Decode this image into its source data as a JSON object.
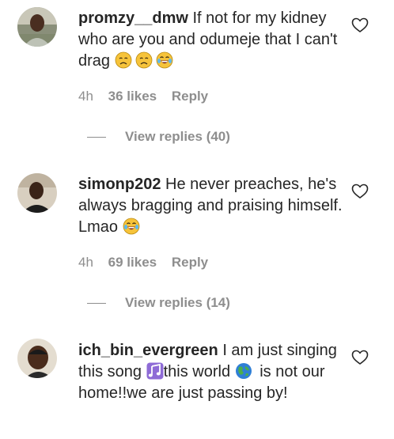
{
  "comments": [
    {
      "username": "promzy__dmw",
      "text": "If not for my kidney who are you and odumeje that I can't drag",
      "time": "4h",
      "likes": "36 likes",
      "reply": "Reply",
      "view_replies": "View replies (40)",
      "emojis": [
        "disappointed-face-emoji",
        "disappointed-face-emoji",
        "crying-laughing-face-emoji"
      ]
    },
    {
      "username": "simonp202",
      "text": "He never preaches, he's always bragging and praising himself. Lmao",
      "time": "4h",
      "likes": "69 likes",
      "reply": "Reply",
      "view_replies": "View replies (14)",
      "emojis": [
        "crying-laughing-face-emoji"
      ]
    },
    {
      "username": "ich_bin_evergreen",
      "text_part1": "I am just singing this song",
      "text_part2": "this world",
      "text_part3": "is not our home!!we are just passing by!",
      "emojis": [
        "musical-notes-emoji",
        "globe-emoji"
      ]
    }
  ],
  "colors": {
    "text": "#262626",
    "secondary": "#8e8e8e",
    "background": "#ffffff"
  }
}
